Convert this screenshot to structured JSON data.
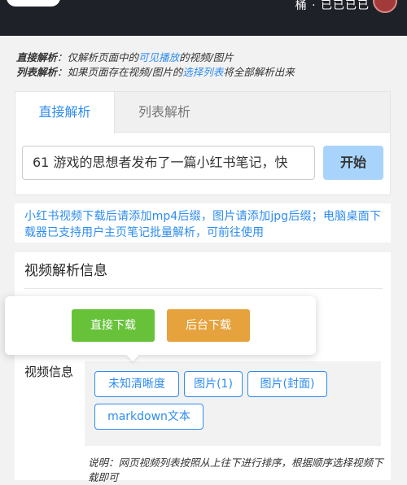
{
  "topbar": {
    "user_text": "桶 · 已已已已"
  },
  "description": {
    "line1": {
      "label": "直接解析",
      "sep": "：",
      "text_a": "仅解析页面中的",
      "link": "可见播放",
      "text_b": "的视频/图片"
    },
    "line2": {
      "label": "列表解析",
      "sep": "：",
      "text_a": "如果页面存在视频/图片的",
      "link": "选择列表",
      "text_b": "将全部解析出来"
    }
  },
  "tabs": [
    {
      "label": "直接解析",
      "active": true
    },
    {
      "label": "列表解析",
      "active": false
    }
  ],
  "input": {
    "value": "61 游戏的思想者发布了一篇小红书笔记，快"
  },
  "start_button": "开始",
  "notice": "小红书视频下载后请添加mp4后缀，图片请添加jpg后缀；电脑桌面下载器已支持用户主页笔记批量解析，可前往使用",
  "info": {
    "title": "视频解析信息",
    "video_label": "视频信息",
    "tags": [
      "未知清晰度",
      "图片(1)",
      "图片(封面)",
      "markdown文本"
    ],
    "note": "说明：网页视频列表按照从上往下进行排序，根据顺序选择视频下载即可"
  },
  "popover": {
    "direct_download": "直接下载",
    "background_download": "后台下载"
  },
  "colors": {
    "accent": "#2d8cf0",
    "green": "#67c23a",
    "orange": "#e6a23c",
    "topbar": "#1f2128"
  }
}
